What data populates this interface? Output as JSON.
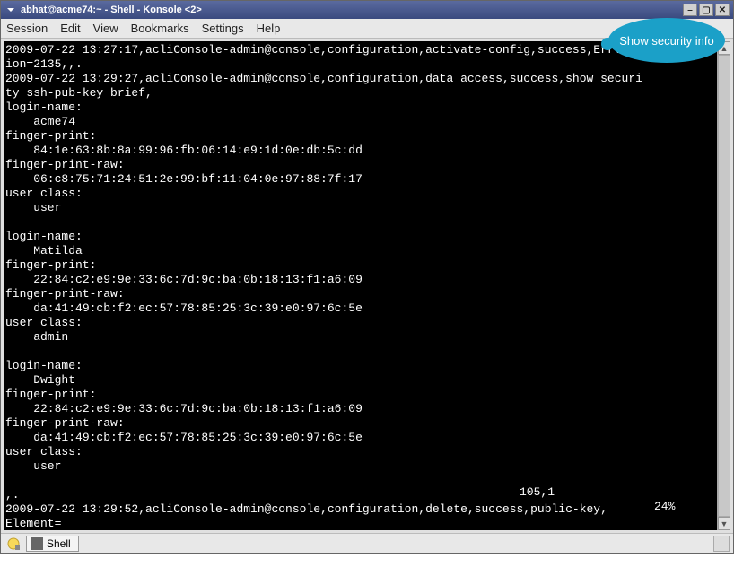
{
  "titlebar": {
    "title": "abhat@acme74:~ - Shell - Konsole <2>"
  },
  "menubar": {
    "items": [
      "Session",
      "Edit",
      "View",
      "Bookmarks",
      "Settings",
      "Help"
    ]
  },
  "terminal": {
    "lines": [
      "2009-07-22 13:27:17,acliConsole-admin@console,configuration,activate-config,success,ErrVers",
      "ion=2135,,.",
      "2009-07-22 13:29:27,acliConsole-admin@console,configuration,data access,success,show securi",
      "ty ssh-pub-key brief,",
      "login-name:",
      "    acme74",
      "finger-print:",
      "    84:1e:63:8b:8a:99:96:fb:06:14:e9:1d:0e:db:5c:dd",
      "finger-print-raw:",
      "    06:c8:75:71:24:51:2e:99:bf:11:04:0e:97:88:7f:17",
      "user class:",
      "    user",
      "",
      "login-name:",
      "    Matilda",
      "finger-print:",
      "    22:84:c2:e9:9e:33:6c:7d:9c:ba:0b:18:13:f1:a6:09",
      "finger-print-raw:",
      "    da:41:49:cb:f2:ec:57:78:85:25:3c:39:e0:97:6c:5e",
      "user class:",
      "    admin",
      "",
      "login-name:",
      "    Dwight",
      "finger-print:",
      "    22:84:c2:e9:9e:33:6c:7d:9c:ba:0b:18:13:f1:a6:09",
      "finger-print-raw:",
      "    da:41:49:cb:f2:ec:57:78:85:25:3c:39:e0:97:6c:5e",
      "user class:",
      "    user",
      "",
      ",.",
      "2009-07-22 13:29:52,acliConsole-admin@console,configuration,delete,success,public-key,",
      "Element="
    ],
    "status_pos": "105,1",
    "status_pct": "24%"
  },
  "taskbar": {
    "tab_label": "Shell"
  },
  "callout": {
    "text": "Show security info"
  }
}
